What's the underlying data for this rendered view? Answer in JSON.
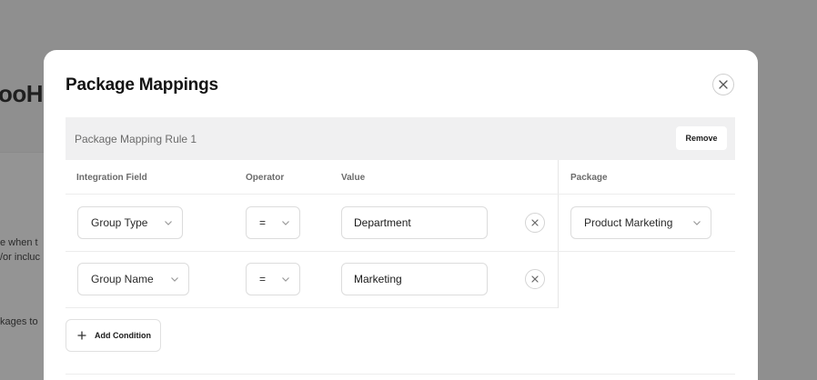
{
  "background": {
    "title_fragment": "ooHI",
    "text_lines": [
      "e when t",
      "/or incluc",
      "kages to"
    ]
  },
  "modal": {
    "title": "Package Mappings",
    "close_icon": "close-icon",
    "rule": {
      "label": "Package Mapping Rule 1",
      "remove_label": "Remove"
    },
    "columns": {
      "integration_field": "Integration Field",
      "operator": "Operator",
      "value": "Value",
      "package": "Package"
    },
    "conditions": [
      {
        "field": "Group Type",
        "operator": "=",
        "value": "Department"
      },
      {
        "field": "Group Name",
        "operator": "=",
        "value": "Marketing"
      }
    ],
    "package_value": "Product Marketing",
    "add_condition_label": "Add Condition"
  }
}
